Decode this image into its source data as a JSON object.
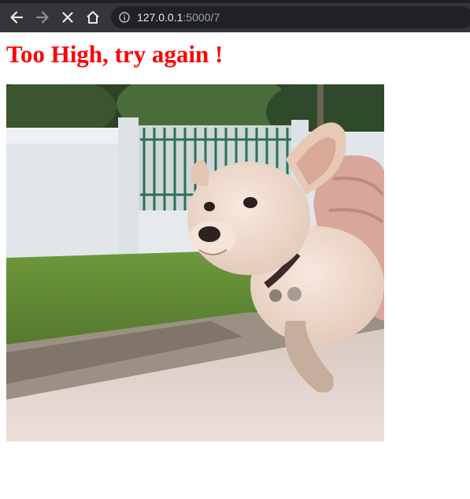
{
  "browser": {
    "url_host": "127.0.0.1",
    "url_path": ":5000/7",
    "icons": [
      "back-arrow-icon",
      "forward-arrow-icon",
      "stop-loading-icon",
      "home-icon",
      "info-icon"
    ]
  },
  "page": {
    "message": "Too High, try again !",
    "message_color": "#ff0000",
    "image_description_icon": "puppy-image"
  }
}
